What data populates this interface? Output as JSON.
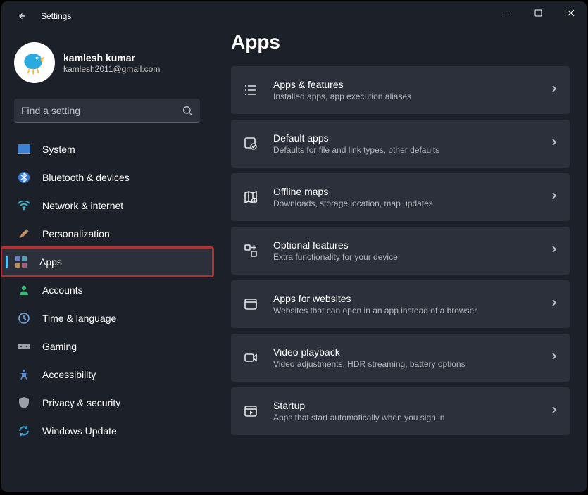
{
  "window": {
    "title": "Settings"
  },
  "profile": {
    "name": "kamlesh kumar",
    "email": "kamlesh2011@gmail.com"
  },
  "search": {
    "placeholder": "Find a setting"
  },
  "page": {
    "title": "Apps"
  },
  "sidebar": {
    "items": [
      {
        "label": "System"
      },
      {
        "label": "Bluetooth & devices"
      },
      {
        "label": "Network & internet"
      },
      {
        "label": "Personalization"
      },
      {
        "label": "Apps"
      },
      {
        "label": "Accounts"
      },
      {
        "label": "Time & language"
      },
      {
        "label": "Gaming"
      },
      {
        "label": "Accessibility"
      },
      {
        "label": "Privacy & security"
      },
      {
        "label": "Windows Update"
      }
    ]
  },
  "cards": [
    {
      "title": "Apps & features",
      "subtitle": "Installed apps, app execution aliases"
    },
    {
      "title": "Default apps",
      "subtitle": "Defaults for file and link types, other defaults"
    },
    {
      "title": "Offline maps",
      "subtitle": "Downloads, storage location, map updates"
    },
    {
      "title": "Optional features",
      "subtitle": "Extra functionality for your device"
    },
    {
      "title": "Apps for websites",
      "subtitle": "Websites that can open in an app instead of a browser"
    },
    {
      "title": "Video playback",
      "subtitle": "Video adjustments, HDR streaming, battery options"
    },
    {
      "title": "Startup",
      "subtitle": "Apps that start automatically when you sign in"
    }
  ],
  "colors": {
    "accent": "#4cc2ff",
    "highlight": "#b33030",
    "cardBg": "#2b303a",
    "windowBg": "#1c2029"
  }
}
